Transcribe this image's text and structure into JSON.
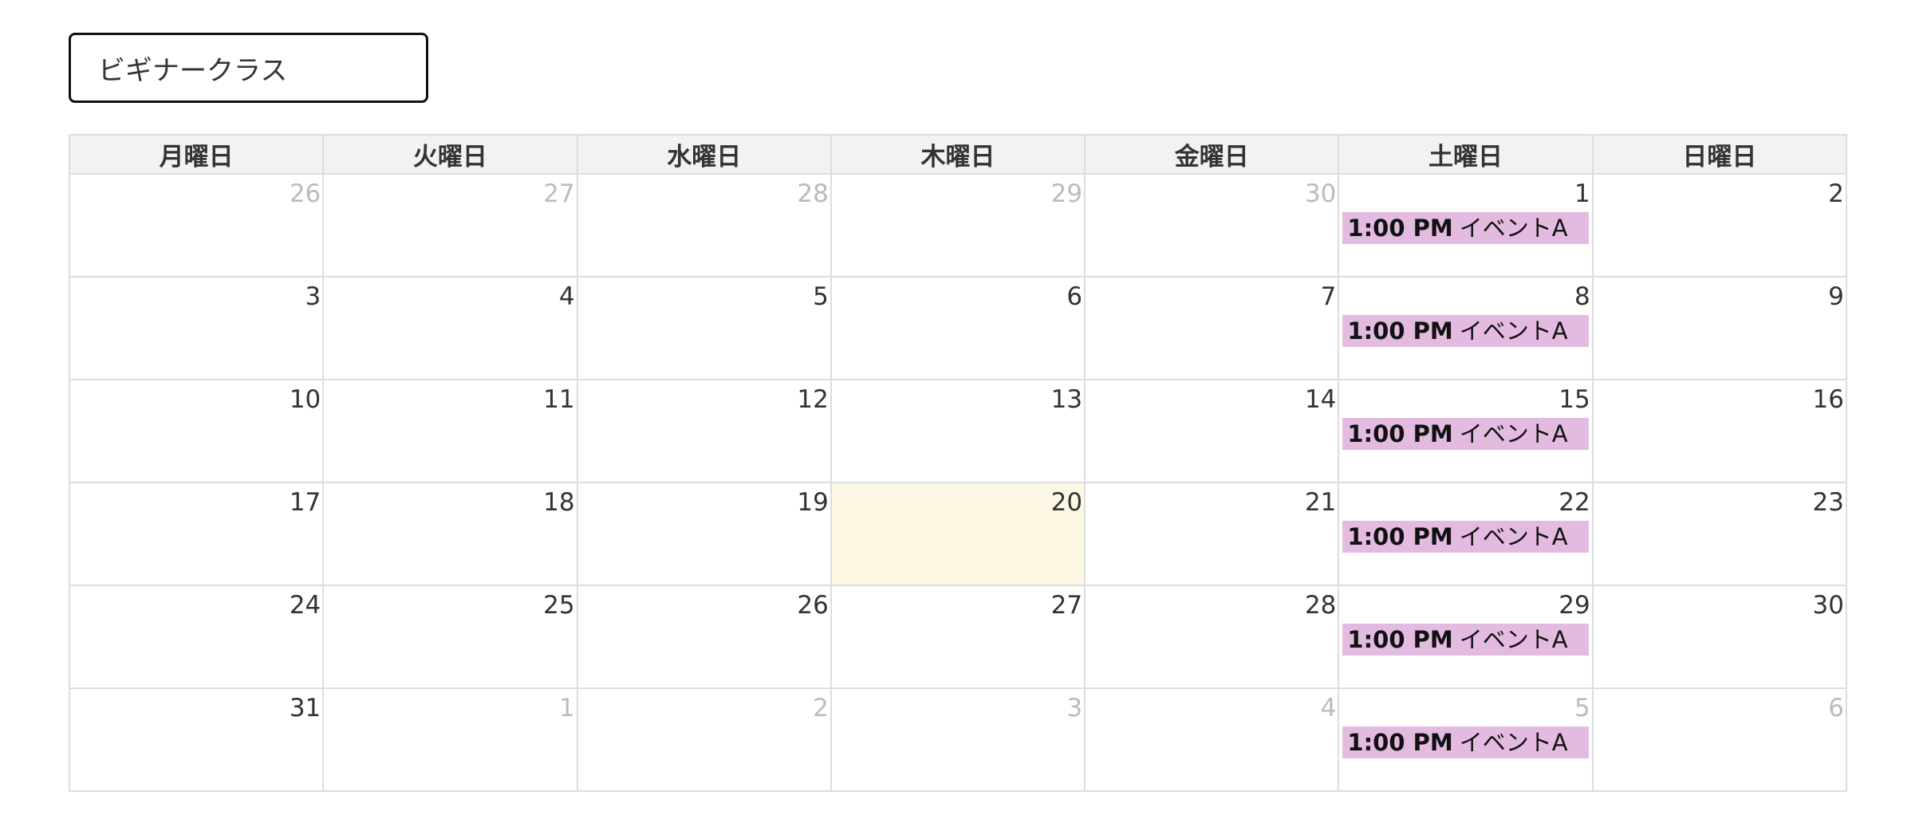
{
  "class_select": {
    "value": "ビギナークラス"
  },
  "weekdays": [
    "月曜日",
    "火曜日",
    "水曜日",
    "木曜日",
    "金曜日",
    "土曜日",
    "日曜日"
  ],
  "weeks": [
    [
      {
        "day": "26",
        "other": true
      },
      {
        "day": "27",
        "other": true
      },
      {
        "day": "28",
        "other": true
      },
      {
        "day": "29",
        "other": true
      },
      {
        "day": "30",
        "other": true
      },
      {
        "day": "1",
        "events": [
          {
            "time": "1:00 PM",
            "title": "イベントA"
          }
        ]
      },
      {
        "day": "2"
      }
    ],
    [
      {
        "day": "3"
      },
      {
        "day": "4"
      },
      {
        "day": "5"
      },
      {
        "day": "6"
      },
      {
        "day": "7"
      },
      {
        "day": "8",
        "events": [
          {
            "time": "1:00 PM",
            "title": "イベントA"
          }
        ]
      },
      {
        "day": "9"
      }
    ],
    [
      {
        "day": "10"
      },
      {
        "day": "11"
      },
      {
        "day": "12"
      },
      {
        "day": "13"
      },
      {
        "day": "14"
      },
      {
        "day": "15",
        "events": [
          {
            "time": "1:00 PM",
            "title": "イベントA"
          }
        ]
      },
      {
        "day": "16"
      }
    ],
    [
      {
        "day": "17"
      },
      {
        "day": "18"
      },
      {
        "day": "19"
      },
      {
        "day": "20",
        "today": true
      },
      {
        "day": "21"
      },
      {
        "day": "22",
        "events": [
          {
            "time": "1:00 PM",
            "title": "イベントA"
          }
        ]
      },
      {
        "day": "23"
      }
    ],
    [
      {
        "day": "24"
      },
      {
        "day": "25"
      },
      {
        "day": "26"
      },
      {
        "day": "27"
      },
      {
        "day": "28"
      },
      {
        "day": "29",
        "events": [
          {
            "time": "1:00 PM",
            "title": "イベントA"
          }
        ]
      },
      {
        "day": "30"
      }
    ],
    [
      {
        "day": "31"
      },
      {
        "day": "1",
        "other": true
      },
      {
        "day": "2",
        "other": true
      },
      {
        "day": "3",
        "other": true
      },
      {
        "day": "4",
        "other": true
      },
      {
        "day": "5",
        "other": true,
        "events": [
          {
            "time": "1:00 PM",
            "title": "イベントA"
          }
        ]
      },
      {
        "day": "6",
        "other": true
      }
    ]
  ],
  "colors": {
    "event_bg": "#e3bbe0",
    "today_bg": "#fcf8e3",
    "header_bg": "#f2f2f2",
    "other_month_text": "#bbbbbb"
  }
}
